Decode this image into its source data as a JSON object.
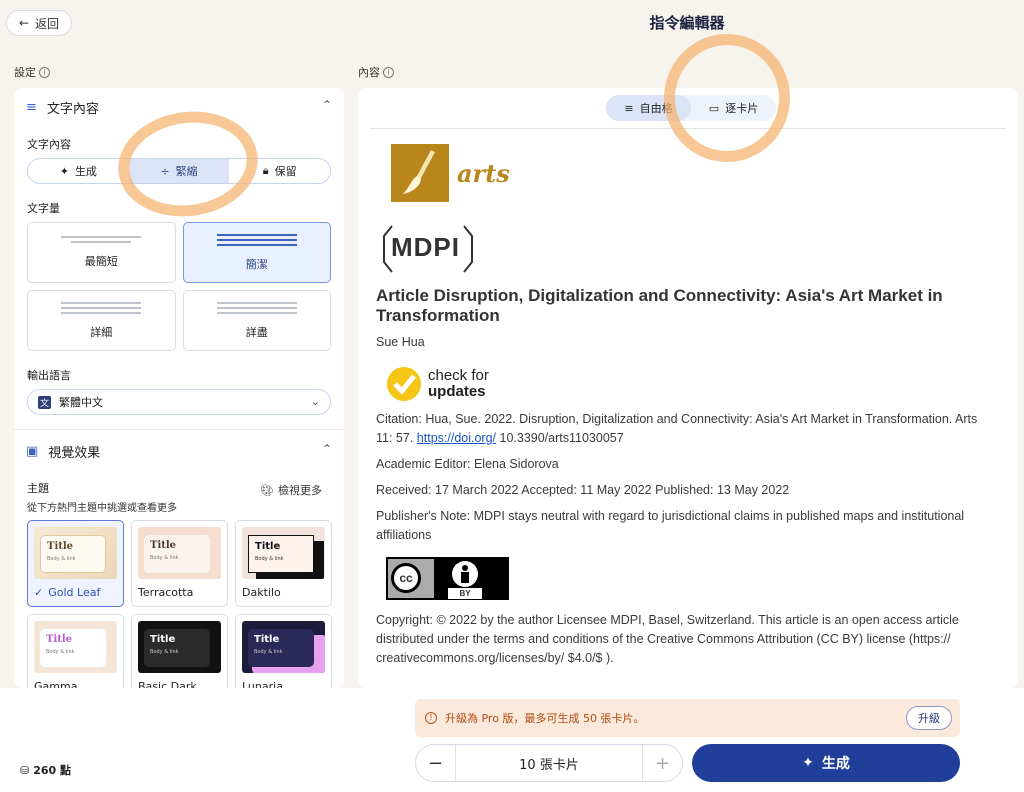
{
  "header": {
    "back_label": "返回",
    "title": "指令編輯器"
  },
  "settings": {
    "label": "設定",
    "text_section": {
      "title": "文字內容",
      "content_label": "文字內容",
      "modes": [
        "生成",
        "緊縮",
        "保留"
      ],
      "active_mode": "緊縮",
      "amount_label": "文字量",
      "amounts": [
        "最簡短",
        "簡潔",
        "詳細",
        "詳盡"
      ],
      "active_amount": "簡潔",
      "language_label": "輸出語言",
      "language_value": "繁體中文"
    },
    "visual_section": {
      "title": "視覺效果",
      "theme_label": "主題",
      "theme_hint": "從下方熱門主題中挑選或查看更多",
      "view_more": "檢視更多",
      "theme_preview_title": "Title",
      "theme_preview_body": "Body & link",
      "themes": [
        "Gold Leaf",
        "Terracotta",
        "Daktilo",
        "Gamma",
        "Basic Dark",
        "Lunaria"
      ],
      "selected_theme": "Gold Leaf"
    }
  },
  "content": {
    "label": "內容",
    "view_modes": [
      "自由格",
      "逐卡片"
    ],
    "active_view": "自由格",
    "document": {
      "journal_name": "arts",
      "publisher_logo": "MDPI",
      "check_updates": [
        "check for",
        "updates"
      ],
      "title": "Article Disruption, Digitalization and Connectivity: Asia's Art Market in Transformation",
      "author": "Sue Hua",
      "citation_prefix": "Citation: Hua, Sue. 2022. Disruption, Digitalization and Connectivity: Asia's Art Market in Transformation. Arts 11: 57.",
      "citation_link": "https://doi.org/",
      "citation_suffix": "10.3390/arts11030057",
      "editor": "Academic Editor: Elena Sidorova",
      "dates": "Received: 17 March 2022 Accepted: 11 May 2022 Published: 13 May 2022",
      "publisher_note": "Publisher's Note: MDPI stays neutral with regard to jurisdictional claims in published maps and institutional affiliations",
      "cc_badge": "BY",
      "copyright": "Copyright: © 2022 by the author Licensee MDPI, Basel, Switzerland. This article is an open access article distributed under the terms and conditions of the Creative Commons Attribution (CC BY) license (https:// creativecommons.org/licenses/by/ $4.0/$ )."
    }
  },
  "footer": {
    "points": "260 點",
    "upsell_text": "升級為 Pro 版，最多可生成 50 張卡片。",
    "upgrade_label": "升級",
    "card_count": "10 張卡片",
    "generate_label": "生成"
  },
  "colors": {
    "accent": "#1f3f9a",
    "annotation": "#f5b26e",
    "upsell_bg": "#fbe9dc"
  }
}
